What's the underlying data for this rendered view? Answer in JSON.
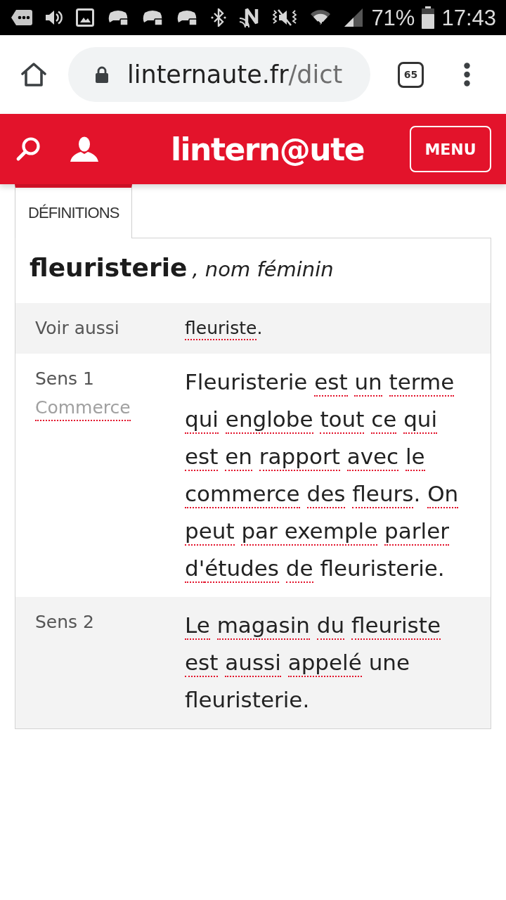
{
  "status_bar": {
    "battery": "71%",
    "time": "17:43"
  },
  "browser": {
    "url_host": "linternaute.fr",
    "url_path": "/dict",
    "tab_count": "65"
  },
  "site_header": {
    "logo": "lintern@ute",
    "menu": "MENU"
  },
  "tabs": [
    {
      "label": "DÉFINITIONS",
      "selected": true
    }
  ],
  "entry": {
    "word": "fleuristerie",
    "category": ", nom féminin",
    "rows": [
      {
        "kind": "see_also",
        "label": "Voir aussi",
        "segments": [
          {
            "text": "fleuriste",
            "link": true,
            "space_after": false
          },
          {
            "text": ".",
            "link": false
          }
        ]
      },
      {
        "kind": "sense",
        "label": "Sens 1",
        "domain": "Commerce",
        "segments": [
          {
            "text": "Fleuristerie",
            "link": false
          },
          {
            "text": "est",
            "link": true
          },
          {
            "text": "un",
            "link": true
          },
          {
            "text": "terme",
            "link": true
          },
          {
            "text": "qui",
            "link": true
          },
          {
            "text": "englobe",
            "link": true
          },
          {
            "text": "tout",
            "link": true
          },
          {
            "text": "ce",
            "link": true
          },
          {
            "text": "qui",
            "link": true
          },
          {
            "text": "est",
            "link": true
          },
          {
            "text": "en",
            "link": true
          },
          {
            "text": "rapport",
            "link": true
          },
          {
            "text": "avec",
            "link": true
          },
          {
            "text": "le",
            "link": true
          },
          {
            "text": "commerce",
            "link": true
          },
          {
            "text": "des",
            "link": true
          },
          {
            "text": "fleurs",
            "link": true,
            "space_after": false
          },
          {
            "text": ".",
            "link": false
          },
          {
            "text": "On",
            "link": true
          },
          {
            "text": "peut",
            "link": true
          },
          {
            "text": "par exemple",
            "link": true
          },
          {
            "text": "parler",
            "link": true
          },
          {
            "text": "d'",
            "link": true,
            "space_after": false
          },
          {
            "text": "études",
            "link": true
          },
          {
            "text": "de",
            "link": true
          },
          {
            "text": "fleuristerie.",
            "link": false
          }
        ]
      },
      {
        "kind": "sense",
        "label": "Sens 2",
        "segments": [
          {
            "text": "Le",
            "link": true
          },
          {
            "text": "magasin",
            "link": true
          },
          {
            "text": "du",
            "link": true
          },
          {
            "text": "fleuriste",
            "link": true
          },
          {
            "text": "est",
            "link": true
          },
          {
            "text": "aussi",
            "link": true
          },
          {
            "text": "appelé",
            "link": true
          },
          {
            "text": "une fleuristerie.",
            "link": false
          }
        ]
      }
    ]
  }
}
